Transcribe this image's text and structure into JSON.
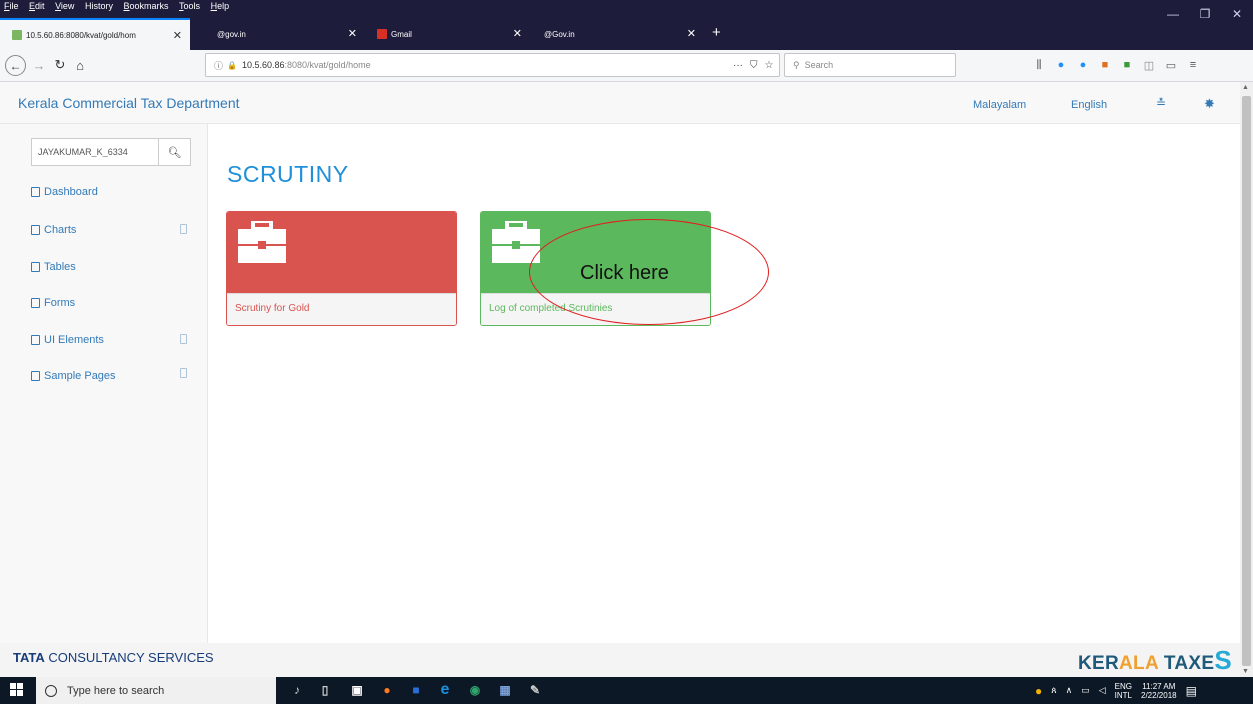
{
  "menubar": {
    "items": [
      {
        "u": "F",
        "rest": "ile"
      },
      {
        "u": "E",
        "rest": "dit"
      },
      {
        "u": "V",
        "rest": "iew"
      },
      {
        "u": "",
        "rest": "History"
      },
      {
        "u": "B",
        "rest": "ookmarks"
      },
      {
        "u": "T",
        "rest": "ools"
      },
      {
        "u": "H",
        "rest": "elp"
      }
    ]
  },
  "tabs": [
    {
      "label": "10.5.60.86:8080/kvat/gold/hom",
      "close": "✕"
    },
    {
      "label": "@gov.in",
      "close": "✕"
    },
    {
      "label": "Gmail",
      "close": "✕"
    },
    {
      "label": "@Gov.in",
      "close": "✕"
    }
  ],
  "new_tab": "+",
  "url": {
    "host": "10.5.60.86",
    "path": ":8080/kvat/gold/home"
  },
  "url_actions": [
    "···",
    "⛉",
    "☆"
  ],
  "search": {
    "placeholder": "Search"
  },
  "page": {
    "brand": "Kerala Commercial Tax Department",
    "lang_malayalam": "Malayalam",
    "lang_english": "English",
    "user_input": "JAYAKUMAR_K_6334",
    "title": "SCRUTINY",
    "sidebar": [
      {
        "label": "Dashboard",
        "arrow": false
      },
      {
        "label": "Charts",
        "arrow": true
      },
      {
        "label": "Tables",
        "arrow": false
      },
      {
        "label": "Forms",
        "arrow": false
      },
      {
        "label": "UI Elements",
        "arrow": true
      },
      {
        "label": "Sample Pages",
        "arrow": true
      }
    ],
    "panels": {
      "red_label": "Scrutiny for Gold",
      "green_label": "Log of completed Scrutinies"
    },
    "annotation": "Click here",
    "footer_left_bold": "TATA",
    "footer_left_rest": " CONSULTANCY SERVICES",
    "footer_right": {
      "a": "KER",
      "b": "ALA",
      "c": " TAX",
      "d": "E",
      "e": "S"
    }
  },
  "taskbar": {
    "search_placeholder": "Type here to search",
    "lang": "ENG",
    "layout": "INTL",
    "time": "11:27 AM",
    "date": "2/22/2018"
  },
  "colors": {
    "link": "#337ab7",
    "danger": "#d9534f",
    "success": "#5cb85c",
    "annotation": "#e01e1e"
  }
}
